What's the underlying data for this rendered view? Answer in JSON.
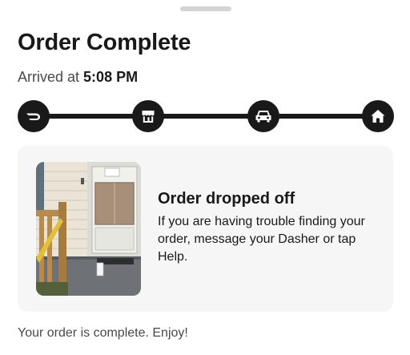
{
  "sheet": {
    "title": "Order Complete",
    "arrival_prefix": "Arrived at",
    "arrival_time": "5:08 PM"
  },
  "tracker": {
    "steps": [
      {
        "icon": "doordash-logo-icon",
        "status": "complete"
      },
      {
        "icon": "store-icon",
        "status": "complete"
      },
      {
        "icon": "car-icon",
        "status": "complete"
      },
      {
        "icon": "home-icon",
        "status": "complete"
      }
    ],
    "color": "#191919"
  },
  "dropoff_card": {
    "title": "Order dropped off",
    "body": "If you are having trouble finding your order, message your Dasher or tap Help.",
    "photo_icon": "dropoff-photo"
  },
  "footer": {
    "message": "Your order is complete. Enjoy!"
  }
}
